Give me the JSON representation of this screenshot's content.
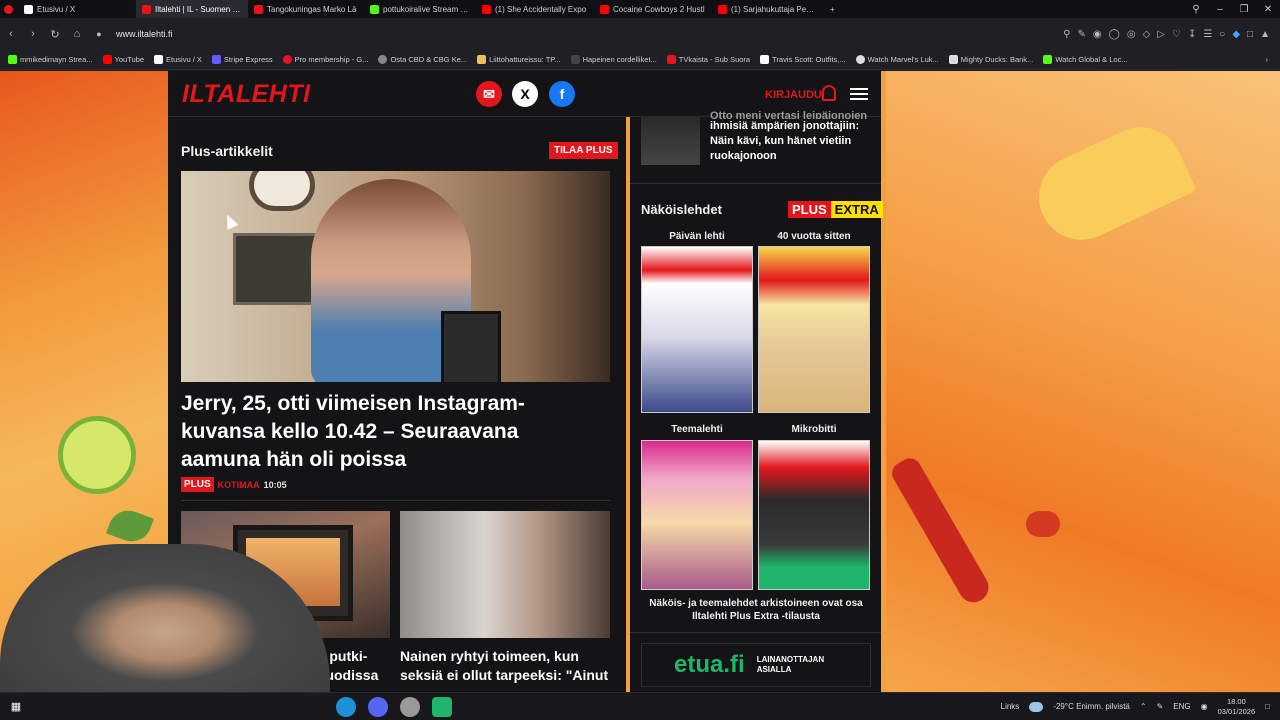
{
  "browser": {
    "tabs": [
      {
        "title": "Etusivu / X",
        "color": "#ffffff",
        "active": false
      },
      {
        "title": "Iltalehti | IL - Suomen suu",
        "color": "#e3161b",
        "active": true
      },
      {
        "title": "Tangokuningas Marko Lä",
        "color": "#e3161b",
        "active": false
      },
      {
        "title": "pottukoiralive Stream - W",
        "color": "#53fc18",
        "active": false
      },
      {
        "title": "(1) She Accidentally Expo",
        "color": "#ff0000",
        "active": false
      },
      {
        "title": "Cocaine Cowboys 2 Hustl",
        "color": "#ff0000",
        "active": false
      },
      {
        "title": "(1) Sarjahukuttaja Pekka S",
        "color": "#ff0000",
        "active": false
      }
    ],
    "new_tab": "+",
    "url": "www.iltalehti.fi",
    "bookmarks": [
      {
        "label": "mmikedimayn Strea...",
        "color": "#53fc18"
      },
      {
        "label": "YouTube",
        "color": "#ff0000"
      },
      {
        "label": "Etusivu / X",
        "color": "#ffffff"
      },
      {
        "label": "Stripe Express",
        "color": "#635bff"
      },
      {
        "label": "Pro membership - G...",
        "color": "#e3161b"
      },
      {
        "label": "Osta CBD & CBG Ke...",
        "color": "#888888"
      },
      {
        "label": "Liittohattureissu: TP...",
        "color": "#e8c15a"
      },
      {
        "label": "Hapeinen cordelliket...",
        "color": "#444444"
      },
      {
        "label": "TVkaista - Sub Suora",
        "color": "#e3161b"
      },
      {
        "label": "Travis Scott: Outfits,...",
        "color": "#ffffff"
      },
      {
        "label": "Watch Marvel's Luk...",
        "color": "#dddddd"
      },
      {
        "label": "Mighty Ducks: Bank...",
        "color": "#dddddd"
      },
      {
        "label": "Watch Global & Loc...",
        "color": "#53fc18"
      }
    ]
  },
  "site": {
    "logo": "ILTALEHTI",
    "login_label": "KIRJAUDU",
    "plus_section": {
      "title": "Plus-artikkelit",
      "subscribe_label": "TILAA PLUS",
      "main_headline": "Jerry, 25, otti viimeisen Instagram-kuvansa kello 10.42 – Seuraavana aamuna hän oli poissa",
      "plus_tag": "PLUS",
      "category": "KOTIMAA",
      "time": "10:05",
      "card1_headline_partial": "at putki-",
      "card1_headline_partial2": "muodissa",
      "card2_headline": "Nainen ryhtyi toimeen, kun seksiä ei ollut tarpeeksi: \"Ainut"
    },
    "sidebar": {
      "top_article": "ihmisiä ämpärien jonottajiin: Näin kävi, kun hänet vietiin ruokajonoon",
      "top_article_line0": "Otto meni vertasi leipäjonojen",
      "nakoislehdet_title": "Näköislehdet",
      "plus_label": "PLUS",
      "extra_label": "EXTRA",
      "covers": [
        {
          "label": "Päivän lehti"
        },
        {
          "label": "40 vuotta sitten"
        },
        {
          "label": "Teemalehti"
        },
        {
          "label": "Mikrobitti"
        }
      ],
      "archive_note": "Näköis- ja teemalehdet arkistoineen ovat osa Iltalehti Plus Extra -tilausta",
      "ad_logo": "etua.fi",
      "ad_text": "LAINANOTTAJAN ASIALLA"
    }
  },
  "taskbar": {
    "links_label": "Links",
    "weather": "-29°C Enimm. pilvistä",
    "lang": "ENG",
    "time": "18.00",
    "date": "03/01/2026"
  }
}
